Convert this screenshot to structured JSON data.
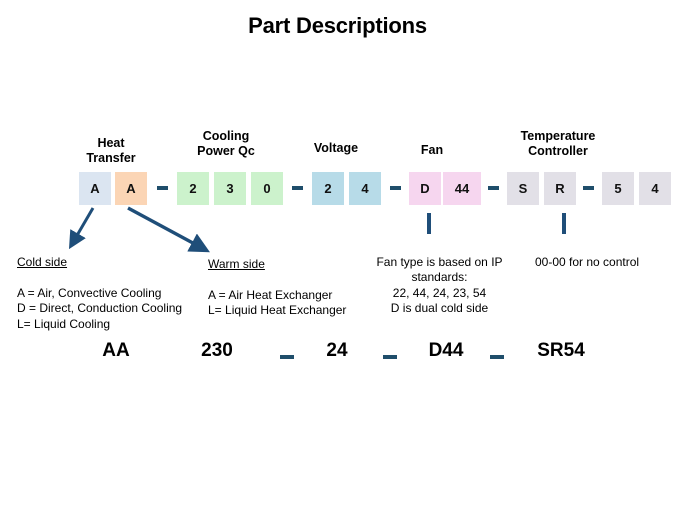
{
  "title": "Part Descriptions",
  "colors": {
    "cold_side_box": "#dbe5f1",
    "warm_side_box": "#fbd5b5",
    "cooling_power_box": "#ccf2cc",
    "voltage_box": "#b7dbe8",
    "fan_box": "#f6d6ef",
    "controller_box": "#e2e0e7",
    "connector": "#1f4e79",
    "dash": "#1f4e6b",
    "text": "#000000"
  },
  "groups": [
    {
      "id": "heat-transfer",
      "label": "Heat\nTransfer"
    },
    {
      "id": "cooling-power",
      "label": "Cooling\nPower Qc"
    },
    {
      "id": "voltage",
      "label": "Voltage"
    },
    {
      "id": "fan",
      "label": "Fan"
    },
    {
      "id": "temperature-controller",
      "label": "Temperature\nController"
    }
  ],
  "code_boxes": [
    {
      "id": "box-cold-side",
      "value": "A",
      "group": "heat-transfer"
    },
    {
      "id": "box-warm-side",
      "value": "A",
      "group": "heat-transfer"
    },
    {
      "id": "box-qc-1",
      "value": "2",
      "group": "cooling-power"
    },
    {
      "id": "box-qc-2",
      "value": "3",
      "group": "cooling-power"
    },
    {
      "id": "box-qc-3",
      "value": "0",
      "group": "cooling-power"
    },
    {
      "id": "box-voltage-1",
      "value": "2",
      "group": "voltage"
    },
    {
      "id": "box-voltage-2",
      "value": "4",
      "group": "voltage"
    },
    {
      "id": "box-fan-1",
      "value": "D",
      "group": "fan"
    },
    {
      "id": "box-fan-2",
      "value": "44",
      "group": "fan"
    },
    {
      "id": "box-ctrl-1",
      "value": "S",
      "group": "temperature-controller"
    },
    {
      "id": "box-ctrl-2",
      "value": "R",
      "group": "temperature-controller"
    },
    {
      "id": "box-ctrl-3",
      "value": "5",
      "group": "temperature-controller"
    },
    {
      "id": "box-ctrl-4",
      "value": "4",
      "group": "temperature-controller"
    }
  ],
  "notes": {
    "cold_side": {
      "heading": "Cold side",
      "body": "A = Air, Convective Cooling\nD = Direct, Conduction Cooling\nL= Liquid Cooling"
    },
    "warm_side": {
      "heading": "Warm side",
      "body": "A = Air Heat Exchanger\nL= Liquid Heat Exchanger"
    },
    "fan": {
      "body": "Fan type is based on IP\nstandards:\n22, 44, 24, 23, 54\nD is dual cold side"
    },
    "controller": {
      "body": "00-00 for  no control"
    }
  },
  "example": {
    "heat_transfer": "AA",
    "cooling_power": "230",
    "voltage": "24",
    "fan": "D44",
    "controller": "SR54",
    "separator": "-"
  }
}
